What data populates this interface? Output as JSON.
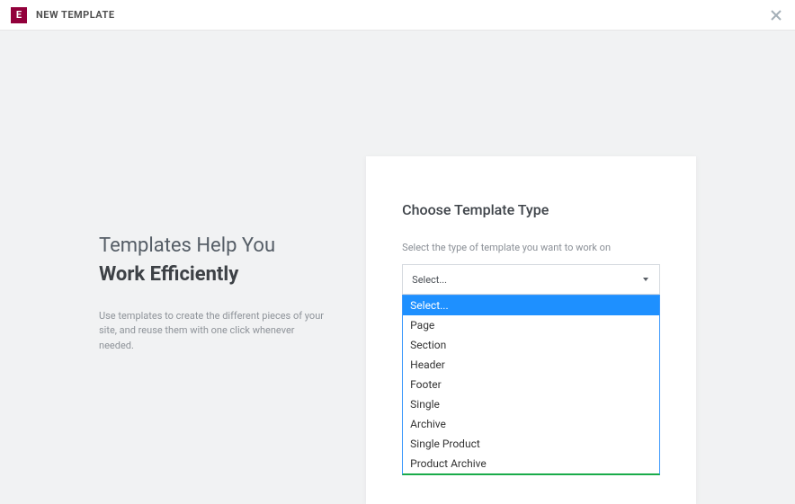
{
  "header": {
    "logo_letter": "E",
    "title": "NEW TEMPLATE"
  },
  "left": {
    "heading_line1": "Templates Help You",
    "heading_line2": "Work Efficiently",
    "description": "Use templates to create the different pieces of your site, and reuse them with one click whenever needed."
  },
  "card": {
    "title": "Choose Template Type",
    "subtitle": "Select the type of template you want to work on",
    "select_placeholder": "Select...",
    "options": [
      "Select...",
      "Page",
      "Section",
      "Header",
      "Footer",
      "Single",
      "Archive",
      "Single Product",
      "Product Archive"
    ],
    "selected_index": 0
  }
}
